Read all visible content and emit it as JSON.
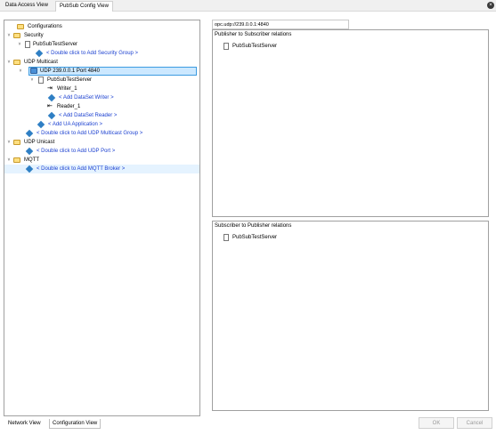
{
  "top_tabs": [
    "Data Access View",
    "PubSub Config View"
  ],
  "tree": {
    "configurations": "Configurations",
    "security": "Security",
    "security_server": "PubSubTestServer",
    "add_security_group": "< Double click to Add Security Group >",
    "udp_multicast": "UDP Multicast",
    "udp_port": "UDP 239.0.0.1 Port 4840",
    "udp_server": "PubSubTestServer",
    "writer": "Writer_1",
    "add_writer": "< Add DataSet Writer >",
    "reader": "Reader_1",
    "add_reader": "< Add DataSet Reader >",
    "add_ua_app": "< Add UA Application >",
    "add_multicast_group": "< Double click to Add UDP Multicast Group >",
    "udp_unicast": "UDP Unicast",
    "add_udp_port": "< Double click to Add UDP Port >",
    "mqtt": "MQTT",
    "add_mqtt_broker": "< Double click to Add MQTT Broker >"
  },
  "bottom_tabs": [
    "Network View",
    "Configuration View"
  ],
  "url": "opc.udp://239.0.0.1:4840",
  "pub_to_sub": {
    "title": "Publisher to Subscriber relations",
    "item": "PubSubTestServer"
  },
  "sub_to_pub": {
    "title": "Subscriber to Publisher relations",
    "item": "PubSubTestServer"
  },
  "buttons": {
    "ok": "OK",
    "cancel": "Cancel"
  },
  "colors": {
    "link": "#1a3fd0",
    "selection": "#cce8ff",
    "folder": "#ffdf80"
  }
}
